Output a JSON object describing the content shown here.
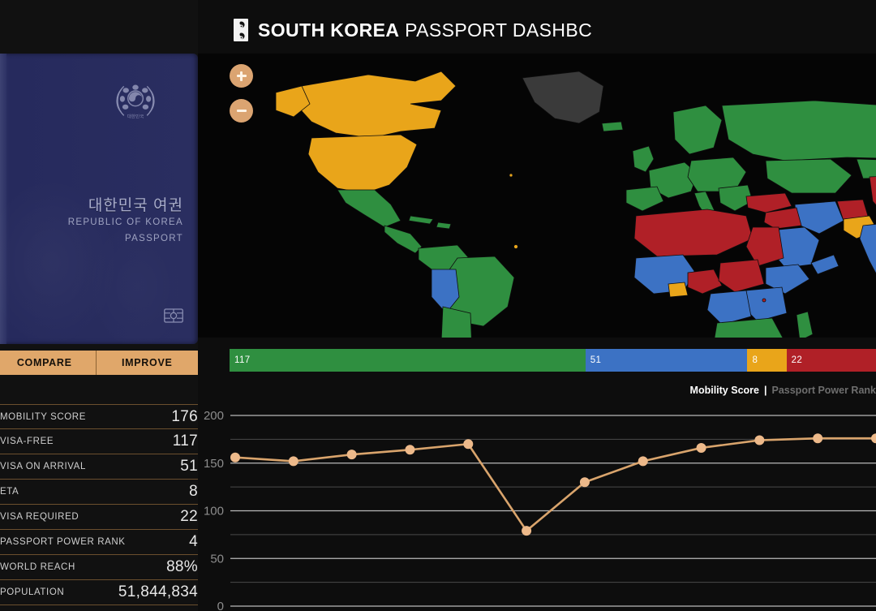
{
  "header": {
    "title_bold": "SOUTH KOREA",
    "title_regular": " PASSPORT DASHBC",
    "flag_icon": "south-korea-flag-icon"
  },
  "passport": {
    "title_ko": "대한민국 여권",
    "title_en_line1": "REPUBLIC OF KOREA",
    "title_en_line2": "PASSPORT",
    "emblem_icon": "korea-national-emblem-icon",
    "chip_icon": "biometric-chip-icon",
    "cover_color": "#2a2e60"
  },
  "actions": {
    "compare_label": "COMPARE",
    "improve_label": "IMPROVE",
    "button_color": "#e0a76a"
  },
  "stats": {
    "rows": [
      {
        "label": "MOBILITY SCORE",
        "value": "176"
      },
      {
        "label": "VISA-FREE",
        "value": "117"
      },
      {
        "label": "VISA ON ARRIVAL",
        "value": "51"
      },
      {
        "label": "ETA",
        "value": "8"
      },
      {
        "label": "VISA REQUIRED",
        "value": "22"
      },
      {
        "label": "PASSPORT POWER RANK",
        "value": "4"
      },
      {
        "label": "WORLD REACH",
        "value": "88%"
      },
      {
        "label": "POPULATION",
        "value": "51,844,834"
      }
    ]
  },
  "map": {
    "zoom_in_label": "+",
    "zoom_out_label": "−",
    "colors": {
      "visa_free": "#2f8f40",
      "visa_on_arrival": "#3c72c4",
      "eta": "#e9a51a",
      "visa_required": "#b02027",
      "no_data": "#3a3a3a",
      "ocean": "#050505"
    }
  },
  "legend_bar": {
    "segments": [
      {
        "name": "visa-free",
        "value": "117",
        "color": "#2f8f40"
      },
      {
        "name": "visa-on-arrival",
        "value": "51",
        "color": "#3c72c4"
      },
      {
        "name": "eta",
        "value": "8",
        "color": "#e9a51a"
      },
      {
        "name": "visa-required",
        "value": "22",
        "color": "#b02027"
      }
    ]
  },
  "chart_tabs": {
    "active": "Mobility Score",
    "separator": "|",
    "inactive": "Passport Power Rank"
  },
  "chart_data": {
    "type": "line",
    "title": "Mobility Score",
    "xlabel": "",
    "ylabel": "",
    "ylim": [
      0,
      200
    ],
    "yticks": [
      0,
      50,
      100,
      150,
      200
    ],
    "minor_gridlines": [
      25,
      75,
      125,
      175
    ],
    "grid": true,
    "legend": "none",
    "line_color": "#d9a46c",
    "marker_color": "#edb98a",
    "x": [
      1,
      2,
      3,
      4,
      5,
      6,
      7,
      8,
      9,
      10,
      11,
      12
    ],
    "values": [
      156,
      152,
      159,
      164,
      170,
      79,
      130,
      152,
      166,
      174,
      176,
      176
    ]
  }
}
